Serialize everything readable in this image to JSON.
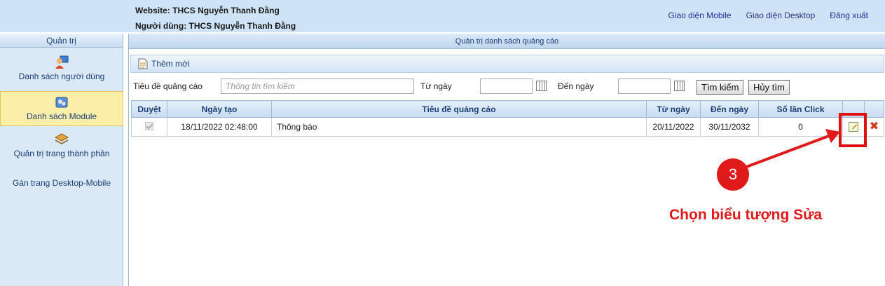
{
  "header": {
    "website": "Website: THCS Nguyễn Thanh Đằng",
    "user": "Người dùng: THCS Nguyễn Thanh Đằng",
    "links": [
      "Giao diện Mobile",
      "Giao diện Desktop",
      "Đăng xuất"
    ]
  },
  "sidebar": {
    "title": "Quản trị",
    "items": [
      {
        "label": "Danh sách người dùng",
        "icon": "user-icon"
      },
      {
        "label": "Danh sách Module",
        "icon": "module-icon",
        "active": true
      },
      {
        "label": "Quản trị trang thành phần",
        "icon": "component-icon"
      },
      {
        "label": "Gán trang Desktop-Mobile"
      }
    ]
  },
  "main": {
    "title": "Quản trị danh sách quảng cáo",
    "add_label": "Thêm mới",
    "filter": {
      "title_label": "Tiêu đề quảng cáo",
      "search_placeholder": "Thông tin tìm kiếm",
      "from_label": "Từ ngày",
      "to_label": "Đến ngày",
      "search_button": "Tìm kiếm",
      "cancel_button": "Hủy tìm"
    },
    "table": {
      "headers": [
        "Duyệt",
        "Ngày tạo",
        "Tiêu đề quảng cáo",
        "Từ ngày",
        "Đến ngày",
        "Số lần Click",
        "",
        ""
      ],
      "rows": [
        {
          "approved": true,
          "created": "18/11/2022 02:48:00",
          "title": "Thông báo",
          "from": "20/11/2022",
          "to": "30/11/2032",
          "clicks": "0"
        }
      ]
    }
  },
  "annotation": {
    "step": "3",
    "text": "Chọn biểu tượng Sửa",
    "color": "#e01a1a"
  }
}
